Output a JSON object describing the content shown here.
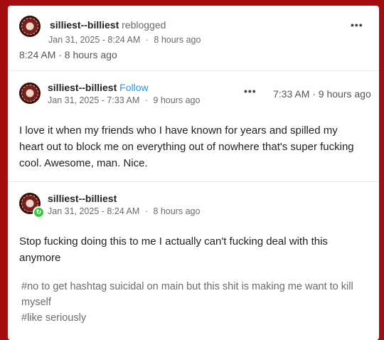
{
  "reblog_header": {
    "username": "silliest--billiest",
    "action": "reblogged",
    "timestamp": "Jan 31, 2025 - 8:24 AM",
    "relative": "8 hours ago",
    "time_line": "8:24 AM · 8 hours ago"
  },
  "original_post": {
    "username": "silliest--billiest",
    "follow_label": "Follow",
    "timestamp": "Jan 31, 2025 - 7:33 AM",
    "relative": "9 hours ago",
    "time_right": "7:33 AM · 9 hours ago",
    "text": "I love it when my friends who I have known for years and spilled my heart out to block me on everything out of nowhere that's super fucking cool. Awesome, man. Nice."
  },
  "reblog_post": {
    "username": "silliest--billiest",
    "timestamp": "Jan 31, 2025 - 8:24 AM",
    "relative": "8 hours ago",
    "text": "Stop fucking doing this to me I actually can't fucking deal with this anymore",
    "tags": [
      "#no to get hashtag suicidal on main but this shit is making me want to kill myself",
      "#like seriously"
    ]
  },
  "menu_glyph": "•••",
  "sync_glyph": "↻",
  "meta_separator": "·"
}
